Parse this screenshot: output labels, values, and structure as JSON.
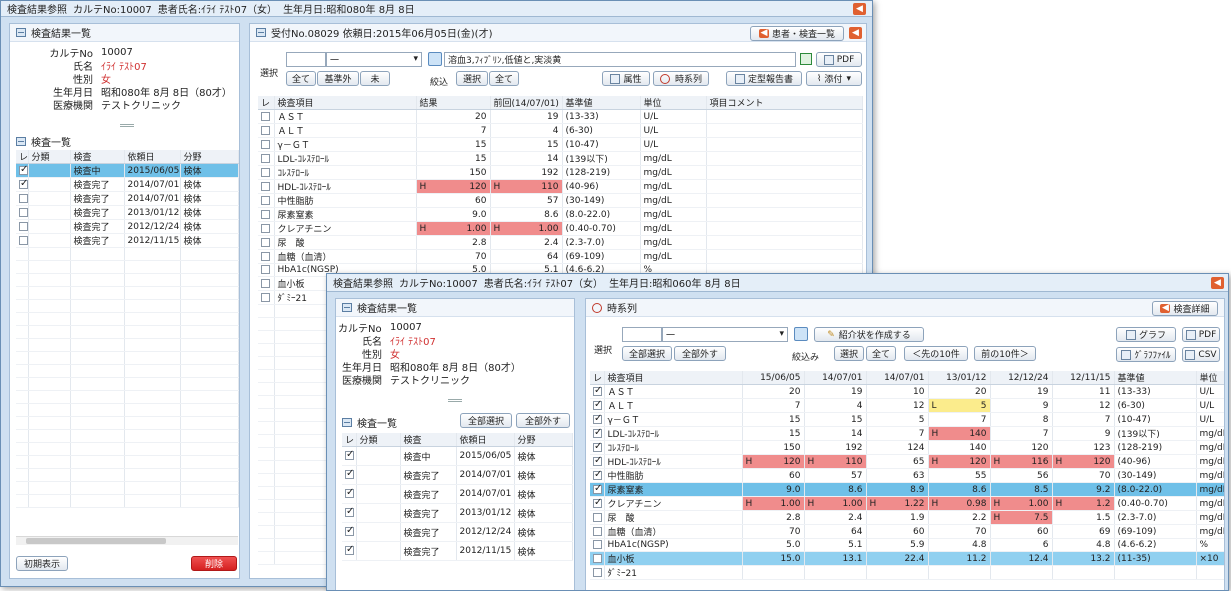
{
  "w1": {
    "title": [
      "検査結果参照",
      "カルテNo:10007",
      "患者氏名:ｲﾗｲ ﾃｽﾄ07（女）",
      "生年月日:昭和080年 8月 8日"
    ],
    "left": {
      "title": "検査結果一覧",
      "info": [
        [
          "カルテNo",
          "10007"
        ],
        [
          "氏名",
          "ｲﾗｲ ﾃｽﾄ07"
        ],
        [
          "性別",
          "女"
        ],
        [
          "生年月日",
          "昭和080年 8月 8日（80才）"
        ],
        [
          "医療機関",
          "テストクリニック"
        ]
      ],
      "list_title": "検査一覧",
      "headers": [
        "レ",
        "分類",
        "検査",
        "依頼日",
        "分野"
      ],
      "rows": [
        {
          "checked": true,
          "cls": "",
          "status": "検査中",
          "date": "2015/06/05",
          "field": "検体",
          "sel": true
        },
        {
          "checked": true,
          "cls": "",
          "status": "検査完了",
          "date": "2014/07/01",
          "field": "検体"
        },
        {
          "checked": false,
          "cls": "",
          "status": "検査完了",
          "date": "2014/07/01",
          "field": "検体"
        },
        {
          "checked": false,
          "cls": "",
          "status": "検査完了",
          "date": "2013/01/12",
          "field": "検体"
        },
        {
          "checked": false,
          "cls": "",
          "status": "検査完了",
          "date": "2012/12/24",
          "field": "検体"
        },
        {
          "checked": false,
          "cls": "",
          "status": "検査完了",
          "date": "2012/11/15",
          "field": "検体"
        }
      ],
      "btn_left": "初期表示",
      "btn_delete": "削除"
    },
    "right": {
      "title": "受付No.08029 依頼日:2015年06月05日(金)(才)",
      "btn_patient": "患者・検査一覧",
      "select_label": "選択",
      "dropdown_value": "一",
      "btn_all": "全て",
      "btn_abnormal": "基準外",
      "btn_none": "未",
      "comment": "溶血3,ﾌｨﾌﾞﾘﾝ,低値と,実淡黄",
      "btn_pdf": "PDF",
      "filter_label": "絞込",
      "btn_select": "選択",
      "btn_all2": "全て",
      "btn_attr": "属性",
      "btn_timeseries": "時系列",
      "btn_report": "定型報告書",
      "btn_attach": "添付",
      "headers": [
        "レ",
        "検査項目",
        "結果",
        "前回(14/07/01)",
        "基準値",
        "単位",
        "項目コメント"
      ],
      "rows": [
        [
          "ＡＳＴ",
          "",
          "20",
          "",
          "19",
          "(13-33)",
          "U/L"
        ],
        [
          "ＡＬＴ",
          "",
          "7",
          "",
          "4",
          "(6-30)",
          "U/L"
        ],
        [
          "γ－ＧＴ",
          "",
          "15",
          "",
          "15",
          "(10-47)",
          "U/L"
        ],
        [
          "LDL-ｺﾚｽﾃﾛｰﾙ",
          "",
          "15",
          "",
          "14",
          "(139以下)",
          "mg/dL"
        ],
        [
          "ｺﾚｽﾃﾛｰﾙ",
          "",
          "150",
          "",
          "192",
          "(128-219)",
          "mg/dL"
        ],
        [
          "HDL-ｺﾚｽﾃﾛｰﾙ",
          "H",
          "120",
          "H",
          "110",
          "(40-96)",
          "mg/dL"
        ],
        [
          "中性脂肪",
          "",
          "60",
          "",
          "57",
          "(30-149)",
          "mg/dL"
        ],
        [
          "尿素窒素",
          "",
          "9.0",
          "",
          "8.6",
          "(8.0-22.0)",
          "mg/dL"
        ],
        [
          "クレアチニン",
          "H",
          "1.00",
          "H",
          "1.00",
          "(0.40-0.70)",
          "mg/dL"
        ],
        [
          "尿　酸",
          "",
          "2.8",
          "",
          "2.4",
          "(2.3-7.0)",
          "mg/dL"
        ],
        [
          "血糖（血清）",
          "",
          "70",
          "",
          "64",
          "(69-109)",
          "mg/dL"
        ],
        [
          "HbA1c(NGSP)",
          "",
          "5.0",
          "",
          "5.1",
          "(4.6-6.2)",
          "%"
        ],
        [
          "血小板",
          "",
          "",
          "",
          "",
          "",
          ""
        ],
        [
          "ﾀﾞﾐｰ21",
          "",
          "",
          "",
          "",
          "",
          ""
        ]
      ]
    }
  },
  "w2": {
    "title": [
      "検査結果参照",
      "カルテNo:10007",
      "患者氏名:ｲﾗｲ ﾃｽﾄ07（女）",
      "生年月日:昭和060年 8月 8日"
    ],
    "left": {
      "title": "検査結果一覧",
      "info": [
        [
          "カルテNo",
          "10007"
        ],
        [
          "氏名",
          "ｲﾗｲ ﾃｽﾄ07"
        ],
        [
          "性別",
          "女"
        ],
        [
          "生年月日",
          "昭和080年 8月 8日（80才）"
        ],
        [
          "医療機関",
          "テストクリニック"
        ]
      ],
      "list_title": "検査一覧",
      "btn_select_all": "全部選択",
      "btn_deselect_all": "全部外す",
      "headers": [
        "レ",
        "分類",
        "検査",
        "依頼日",
        "分野"
      ],
      "rows": [
        {
          "checked": true,
          "status": "検査中",
          "date": "2015/06/05",
          "field": "検体"
        },
        {
          "checked": true,
          "status": "検査完了",
          "date": "2014/07/01",
          "field": "検体"
        },
        {
          "checked": true,
          "status": "検査完了",
          "date": "2014/07/01",
          "field": "検体"
        },
        {
          "checked": true,
          "status": "検査完了",
          "date": "2013/01/12",
          "field": "検体"
        },
        {
          "checked": true,
          "status": "検査完了",
          "date": "2012/12/24",
          "field": "検体"
        },
        {
          "checked": true,
          "status": "検査完了",
          "date": "2012/11/15",
          "field": "検体"
        }
      ]
    },
    "right": {
      "title": "時系列",
      "btn_detail": "検査詳細",
      "select_label": "選択",
      "dropdown_value": "一",
      "btn_select_all": "全部選択",
      "btn_deselect_all": "全部外す",
      "btn_referral": "紹介状を作成する",
      "btn_graph": "グラフ",
      "btn_pdf": "PDF",
      "filter_label": "絞込み",
      "btn_select": "選択",
      "btn_all": "全て",
      "btn_prev": "＜先の10件",
      "btn_next": "前の10件＞",
      "btn_graphfile": "ｸﾞﾗﾌﾌｧｲﾙ",
      "btn_csv": "CSV",
      "headers": [
        "レ",
        "検査項目",
        "15/06/05",
        "14/07/01",
        "14/07/01",
        "13/01/12",
        "12/12/24",
        "12/11/15",
        "基準値",
        "単位"
      ],
      "rows": [
        {
          "c": true,
          "name": "ＡＳＴ",
          "v": [
            [
              "",
              "20"
            ],
            [
              "",
              "19"
            ],
            [
              "",
              "10"
            ],
            [
              "",
              "20"
            ],
            [
              "",
              "19"
            ],
            [
              "",
              "11"
            ]
          ],
          "ref": "(13-33)",
          "unit": "U/L"
        },
        {
          "c": true,
          "name": "ＡＬＴ",
          "v": [
            [
              "",
              "7"
            ],
            [
              "",
              "4"
            ],
            [
              "",
              "12"
            ],
            [
              "L",
              "5"
            ],
            [
              "",
              "9"
            ],
            [
              "",
              "12"
            ]
          ],
          "ref": "(6-30)",
          "unit": "U/L"
        },
        {
          "c": true,
          "name": "γ－ＧＴ",
          "v": [
            [
              "",
              "15"
            ],
            [
              "",
              "15"
            ],
            [
              "",
              "5"
            ],
            [
              "",
              "7"
            ],
            [
              "",
              "8"
            ],
            [
              "",
              "7"
            ]
          ],
          "ref": "(10-47)",
          "unit": "U/L"
        },
        {
          "c": true,
          "name": "LDL-ｺﾚｽﾃﾛｰﾙ",
          "v": [
            [
              "",
              "15"
            ],
            [
              "",
              "14"
            ],
            [
              "",
              "7"
            ],
            [
              "H",
              "140"
            ],
            [
              "",
              "7"
            ],
            [
              "",
              "9"
            ]
          ],
          "ref": "(139以下)",
          "unit": "mg/dL"
        },
        {
          "c": true,
          "name": "ｺﾚｽﾃﾛｰﾙ",
          "v": [
            [
              "",
              "150"
            ],
            [
              "",
              "192"
            ],
            [
              "",
              "124"
            ],
            [
              "",
              "140"
            ],
            [
              "",
              "120"
            ],
            [
              "",
              "123"
            ]
          ],
          "ref": "(128-219)",
          "unit": "mg/dL"
        },
        {
          "c": true,
          "name": "HDL-ｺﾚｽﾃﾛｰﾙ",
          "v": [
            [
              "H",
              "120"
            ],
            [
              "H",
              "110"
            ],
            [
              "",
              "65"
            ],
            [
              "H",
              "120"
            ],
            [
              "H",
              "116"
            ],
            [
              "H",
              "120"
            ]
          ],
          "ref": "(40-96)",
          "unit": "mg/dL"
        },
        {
          "c": true,
          "name": "中性脂肪",
          "v": [
            [
              "",
              "60"
            ],
            [
              "",
              "57"
            ],
            [
              "",
              "63"
            ],
            [
              "",
              "55"
            ],
            [
              "",
              "56"
            ],
            [
              "",
              "70"
            ]
          ],
          "ref": "(30-149)",
          "unit": "mg/dL"
        },
        {
          "c": true,
          "name": "尿素窒素",
          "v": [
            [
              "",
              "9.0"
            ],
            [
              "",
              "8.6"
            ],
            [
              "",
              "8.9"
            ],
            [
              "",
              "8.6"
            ],
            [
              "",
              "8.5"
            ],
            [
              "",
              "9.2"
            ]
          ],
          "ref": "(8.0-22.0)",
          "unit": "mg/dL",
          "sel": true
        },
        {
          "c": true,
          "name": "クレアチニン",
          "v": [
            [
              "H",
              "1.00"
            ],
            [
              "H",
              "1.00"
            ],
            [
              "H",
              "1.22"
            ],
            [
              "H",
              "0.98"
            ],
            [
              "H",
              "1.00"
            ],
            [
              "H",
              "1.2"
            ]
          ],
          "ref": "(0.40-0.70)",
          "unit": "mg/dL"
        },
        {
          "c": false,
          "name": "尿　酸",
          "v": [
            [
              "",
              "2.8"
            ],
            [
              "",
              "2.4"
            ],
            [
              "",
              "1.9"
            ],
            [
              "",
              "2.2"
            ],
            [
              "H",
              "7.5"
            ],
            [
              "",
              "1.5"
            ]
          ],
          "ref": "(2.3-7.0)",
          "unit": "mg/dL"
        },
        {
          "c": false,
          "name": "血糖（血清）",
          "v": [
            [
              "",
              "70"
            ],
            [
              "",
              "64"
            ],
            [
              "",
              "60"
            ],
            [
              "",
              "70"
            ],
            [
              "",
              "60"
            ],
            [
              "",
              "69"
            ]
          ],
          "ref": "(69-109)",
          "unit": "mg/dL"
        },
        {
          "c": false,
          "name": "HbA1c(NGSP)",
          "v": [
            [
              "",
              "5.0"
            ],
            [
              "",
              "5.1"
            ],
            [
              "",
              "5.9"
            ],
            [
              "",
              "4.8"
            ],
            [
              "",
              "6"
            ],
            [
              "",
              "4.8"
            ]
          ],
          "ref": "(4.6-6.2)",
          "unit": "%"
        },
        {
          "c": false,
          "name": "血小板",
          "v": [
            [
              "",
              "15.0"
            ],
            [
              "",
              "13.1"
            ],
            [
              "",
              "22.4"
            ],
            [
              "",
              "11.2"
            ],
            [
              "",
              "12.4"
            ],
            [
              "",
              "13.2"
            ]
          ],
          "ref": "(11-35)",
          "unit": "×10",
          "sel2": true
        },
        {
          "c": false,
          "name": "ﾀﾞﾐｰ21",
          "v": [
            [
              "",
              ""
            ],
            [
              "",
              ""
            ],
            [
              "",
              ""
            ],
            [
              "",
              ""
            ],
            [
              "",
              ""
            ],
            [
              "",
              ""
            ]
          ],
          "ref": "",
          "unit": ""
        }
      ]
    }
  }
}
